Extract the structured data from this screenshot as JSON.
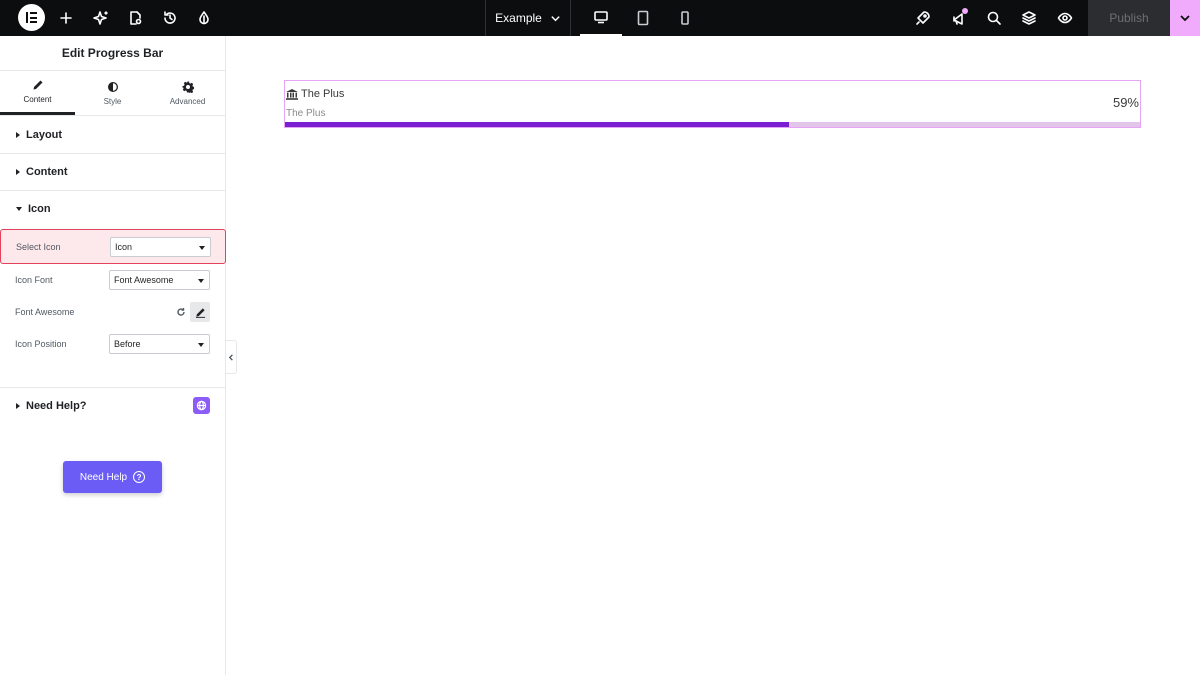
{
  "topbar": {
    "page_name": "Example",
    "publish_label": "Publish",
    "icons": [
      "elementor-logo-icon",
      "plus-icon",
      "sparkle-icon",
      "page-settings-icon",
      "history-icon",
      "drop-icon",
      "rocket-icon",
      "megaphone-icon",
      "search-icon",
      "layers-icon",
      "eye-icon"
    ],
    "devices": [
      "desktop",
      "tablet",
      "mobile"
    ],
    "active_device": "desktop",
    "accent": "#f0abfc"
  },
  "panel": {
    "title": "Edit Progress Bar",
    "tabs": [
      {
        "label": "Content",
        "icon": "pencil-icon",
        "active": true
      },
      {
        "label": "Style",
        "icon": "half-circle-icon",
        "active": false
      },
      {
        "label": "Advanced",
        "icon": "gear-icon",
        "active": false
      }
    ],
    "sections": {
      "layout": "Layout",
      "content": "Content",
      "icon": "Icon",
      "help": "Need Help?"
    },
    "controls": {
      "select_icon_label": "Select Icon",
      "select_icon_value": "Icon",
      "icon_font_label": "Icon Font",
      "icon_font_value": "Font Awesome",
      "font_awesome_label": "Font Awesome",
      "icon_position_label": "Icon Position",
      "icon_position_value": "Before"
    },
    "need_help_button": "Need Help",
    "need_help_q": "?"
  },
  "canvas": {
    "title": "The Plus",
    "subtitle": "The Plus",
    "value_text": "59%",
    "progress": 59,
    "fill_color": "#7b1fd2",
    "track_color": "#e2c6ea"
  }
}
